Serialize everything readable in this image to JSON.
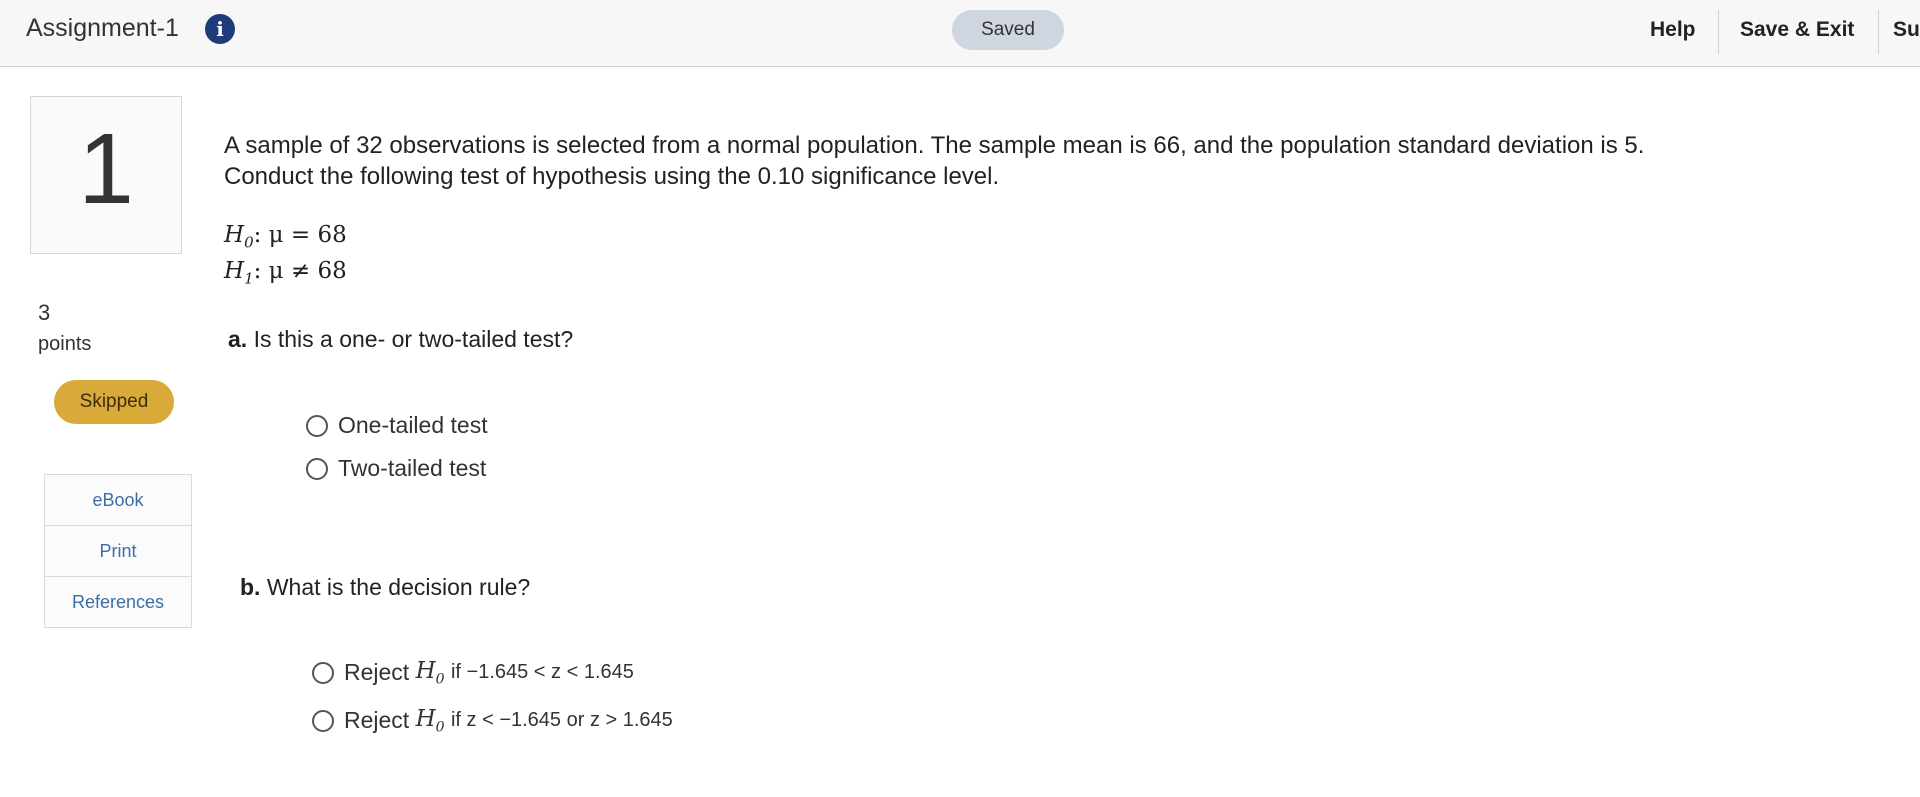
{
  "header": {
    "title": "Assignment-1",
    "info_icon": "info-icon",
    "saved_label": "Saved",
    "help_label": "Help",
    "save_exit_label": "Save & Exit",
    "submit_label": "Su"
  },
  "question": {
    "number": "1",
    "points_value": "3",
    "points_label": "points",
    "status_label": "Skipped",
    "tools": [
      "eBook",
      "Print",
      "References"
    ],
    "text_line1": "A sample of 32 observations is selected from a normal population. The sample mean is 66, and the population standard deviation is 5.",
    "text_line2": "Conduct the following test of hypothesis using the 0.10 significance level.",
    "h0": {
      "symbol": "H",
      "sub": "0",
      "rest": ": μ = 68"
    },
    "h1": {
      "symbol": "H",
      "sub": "1",
      "rest": ": μ ≠ 68"
    }
  },
  "part_a": {
    "letter": "a.",
    "prompt": "Is this a one- or two-tailed test?",
    "options": [
      "One-tailed test",
      "Two-tailed test"
    ]
  },
  "part_b": {
    "letter": "b.",
    "prompt": "What is the decision rule?",
    "options": [
      {
        "prefix": "Reject",
        "h": "H",
        "sub": "0",
        "rule": "if −1.645 < z < 1.645"
      },
      {
        "prefix": "Reject",
        "h": "H",
        "sub": "0",
        "rule": "if z < −1.645 or z > 1.645"
      }
    ]
  },
  "colors": {
    "saved_bg": "#cfd6df",
    "skipped_bg": "#d9a93a",
    "info_bg": "#1d3d7a",
    "link": "#3a6ea5"
  }
}
